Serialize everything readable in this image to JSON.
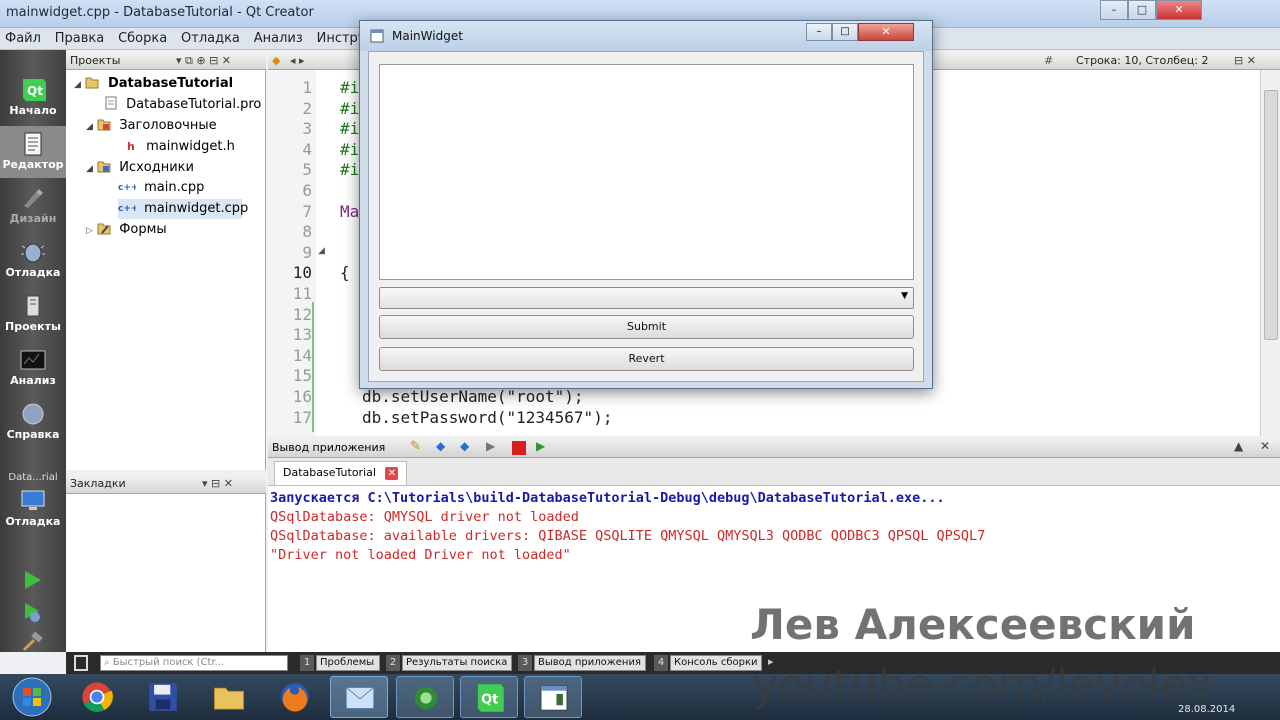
{
  "window": {
    "title": "mainwidget.cpp - DatabaseTutorial - Qt Creator"
  },
  "menu": [
    "Файл",
    "Правка",
    "Сборка",
    "Отладка",
    "Анализ",
    "Инстру"
  ],
  "modes": [
    {
      "label": "Начало",
      "icon": "qt-logo-icon"
    },
    {
      "label": "Редактор",
      "icon": "editor-icon"
    },
    {
      "label": "Дизайн",
      "icon": "design-icon"
    },
    {
      "label": "Отладка",
      "icon": "debug-icon"
    },
    {
      "label": "Проекты",
      "icon": "projects-icon"
    },
    {
      "label": "Анализ",
      "icon": "analyze-icon"
    },
    {
      "label": "Справка",
      "icon": "help-icon"
    }
  ],
  "kit": {
    "name": "Data...rial",
    "mode_label": "Отладка"
  },
  "projects_pane": {
    "title": "Проекты"
  },
  "tree": [
    {
      "label": "DatabaseTutorial",
      "level": 0,
      "bold": true,
      "icon": "project-folder-icon"
    },
    {
      "label": "DatabaseTutorial.pro",
      "level": 1,
      "icon": "pro-file-icon"
    },
    {
      "label": "Заголовочные",
      "level": 1,
      "icon": "folder-icon"
    },
    {
      "label": "mainwidget.h",
      "level": 2,
      "icon": "header-file-icon"
    },
    {
      "label": "Исходники",
      "level": 1,
      "icon": "folder-icon"
    },
    {
      "label": "main.cpp",
      "level": 2,
      "icon": "cpp-file-icon"
    },
    {
      "label": "mainwidget.cpp",
      "level": 2,
      "icon": "cpp-file-icon",
      "selected": true
    },
    {
      "label": "Формы",
      "level": 1,
      "icon": "forms-folder-icon"
    }
  ],
  "bookmarks": {
    "title": "Закладки"
  },
  "editor": {
    "cursor_info": "Строка: 10, Столбец: 2",
    "line_numbers": [
      "1",
      "2",
      "3",
      "4",
      "5",
      "6",
      "7",
      "8",
      "9",
      "10",
      "11",
      "12",
      "13",
      "14",
      "15",
      "16",
      "17"
    ],
    "visible_code": [
      {
        "line": 1,
        "text": "#i"
      },
      {
        "line": 2,
        "text": "#i"
      },
      {
        "line": 3,
        "text": "#i"
      },
      {
        "line": 4,
        "text": "#i"
      },
      {
        "line": 5,
        "text": "#i"
      },
      {
        "line": 7,
        "text": "Ma"
      },
      {
        "line": 10,
        "text": "{"
      },
      {
        "line": 16,
        "text": "db.setUserName(\"root\");"
      },
      {
        "line": 17,
        "text": "db.setPassword(\"1234567\");"
      }
    ]
  },
  "output": {
    "pane_title": "Вывод приложения",
    "tab_label": "DatabaseTutorial",
    "lines": [
      {
        "text": "Запускается C:\\Tutorials\\build-DatabaseTutorial-Debug\\debug\\DatabaseTutorial.exe...",
        "color": "#1a1aa8",
        "bold": true
      },
      {
        "text": "QSqlDatabase: QMYSQL driver not loaded",
        "color": "#cc2a2a"
      },
      {
        "text": "QSqlDatabase: available drivers: QIBASE QSQLITE QMYSQL QMYSQL3 QODBC QODBC3 QPSQL QPSQL7",
        "color": "#cc2a2a"
      },
      {
        "text": "\"Driver not loaded Driver not loaded\"",
        "color": "#cc2a2a"
      }
    ]
  },
  "statusbar": {
    "search_placeholder": "Быстрый поиск (Ctr...",
    "tabs": [
      {
        "num": "1",
        "label": "Проблемы"
      },
      {
        "num": "2",
        "label": "Результаты поиска"
      },
      {
        "num": "3",
        "label": "Вывод приложения"
      },
      {
        "num": "4",
        "label": "Консоль сборки"
      }
    ]
  },
  "dialog": {
    "title": "MainWidget",
    "submit_label": "Submit",
    "revert_label": "Revert"
  },
  "watermark": {
    "author": "Лев Алексеевский",
    "url": "youtube.com/levolex"
  },
  "taskbar": {
    "date": "28.08.2014",
    "apps": [
      "windows-start-icon",
      "chrome-icon",
      "save-disk-icon",
      "explorer-folder-icon",
      "firefox-icon",
      "mail-app-icon",
      "network-app-icon",
      "qt-creator-icon",
      "window-app-icon"
    ]
  },
  "colors": {
    "accent": "#41cd52",
    "error": "#cc2a2a",
    "launch": "#1a1aa8"
  }
}
